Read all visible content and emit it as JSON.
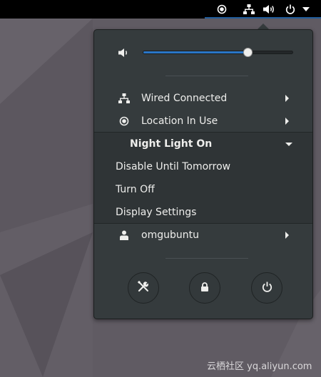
{
  "topbar": {
    "icons": [
      "location-icon",
      "network-wired-icon",
      "volume-high-icon",
      "power-icon",
      "dropdown-arrow-icon"
    ]
  },
  "volume": {
    "icon": "volume-low-icon",
    "level": 0.7
  },
  "menu": {
    "items": [
      {
        "icon": "network-wired-icon",
        "label": "Wired Connected"
      },
      {
        "icon": "location-icon",
        "label": "Location In Use"
      }
    ],
    "night_light": {
      "label": "Night Light On",
      "submenu": [
        "Disable Until Tomorrow",
        "Turn Off",
        "Display Settings"
      ]
    },
    "user": {
      "icon": "user-icon",
      "label": "omgubuntu"
    },
    "actions": [
      "settings-icon",
      "lock-icon",
      "power-icon"
    ]
  },
  "watermark": "云栖社区 yq.aliyun.com",
  "colors": {
    "panel": "#353b3d",
    "accent": "#2a76c6",
    "topbar": "#000000"
  }
}
